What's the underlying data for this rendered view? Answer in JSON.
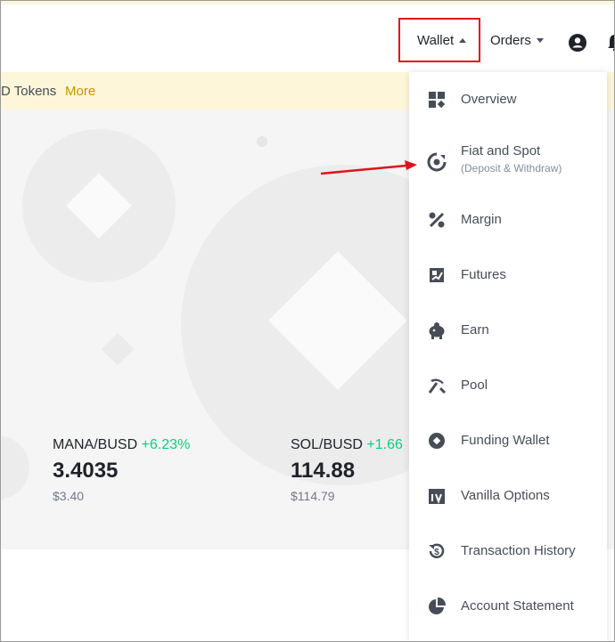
{
  "header": {
    "nav": {
      "wallet_label": "Wallet",
      "orders_label": "Orders"
    },
    "icons": [
      "user-icon",
      "bell-icon"
    ]
  },
  "banner": {
    "text": "D Tokens",
    "more_label": "More"
  },
  "tickers": [
    {
      "pair": "MANA/BUSD",
      "change": "+6.23%",
      "price": "3.4035",
      "usd": "$3.40"
    },
    {
      "pair": "SOL/BUSD",
      "change": "+1.66",
      "price": "114.88",
      "usd": "$114.79"
    }
  ],
  "wallet_menu": {
    "items": [
      {
        "label": "Overview",
        "icon": "grid-icon"
      },
      {
        "label": "Fiat and Spot",
        "sublabel": "(Deposit & Withdraw)",
        "icon": "fiat-spot-icon"
      },
      {
        "label": "Margin",
        "icon": "percent-icon"
      },
      {
        "label": "Futures",
        "icon": "futures-icon"
      },
      {
        "label": "Earn",
        "icon": "piggy-bank-icon"
      },
      {
        "label": "Pool",
        "icon": "pickaxe-icon"
      },
      {
        "label": "Funding Wallet",
        "icon": "funding-icon"
      },
      {
        "label": "Vanilla Options",
        "icon": "options-icon"
      },
      {
        "label": "Transaction History",
        "icon": "history-icon"
      },
      {
        "label": "Account Statement",
        "icon": "pie-chart-icon"
      }
    ]
  },
  "colors": {
    "highlight_box": "#e0121b",
    "annotation_arrow": "#e0121b",
    "positive_change": "#0ecb81",
    "more_link": "#c99400",
    "banner_bg": "#fdf6d8"
  }
}
